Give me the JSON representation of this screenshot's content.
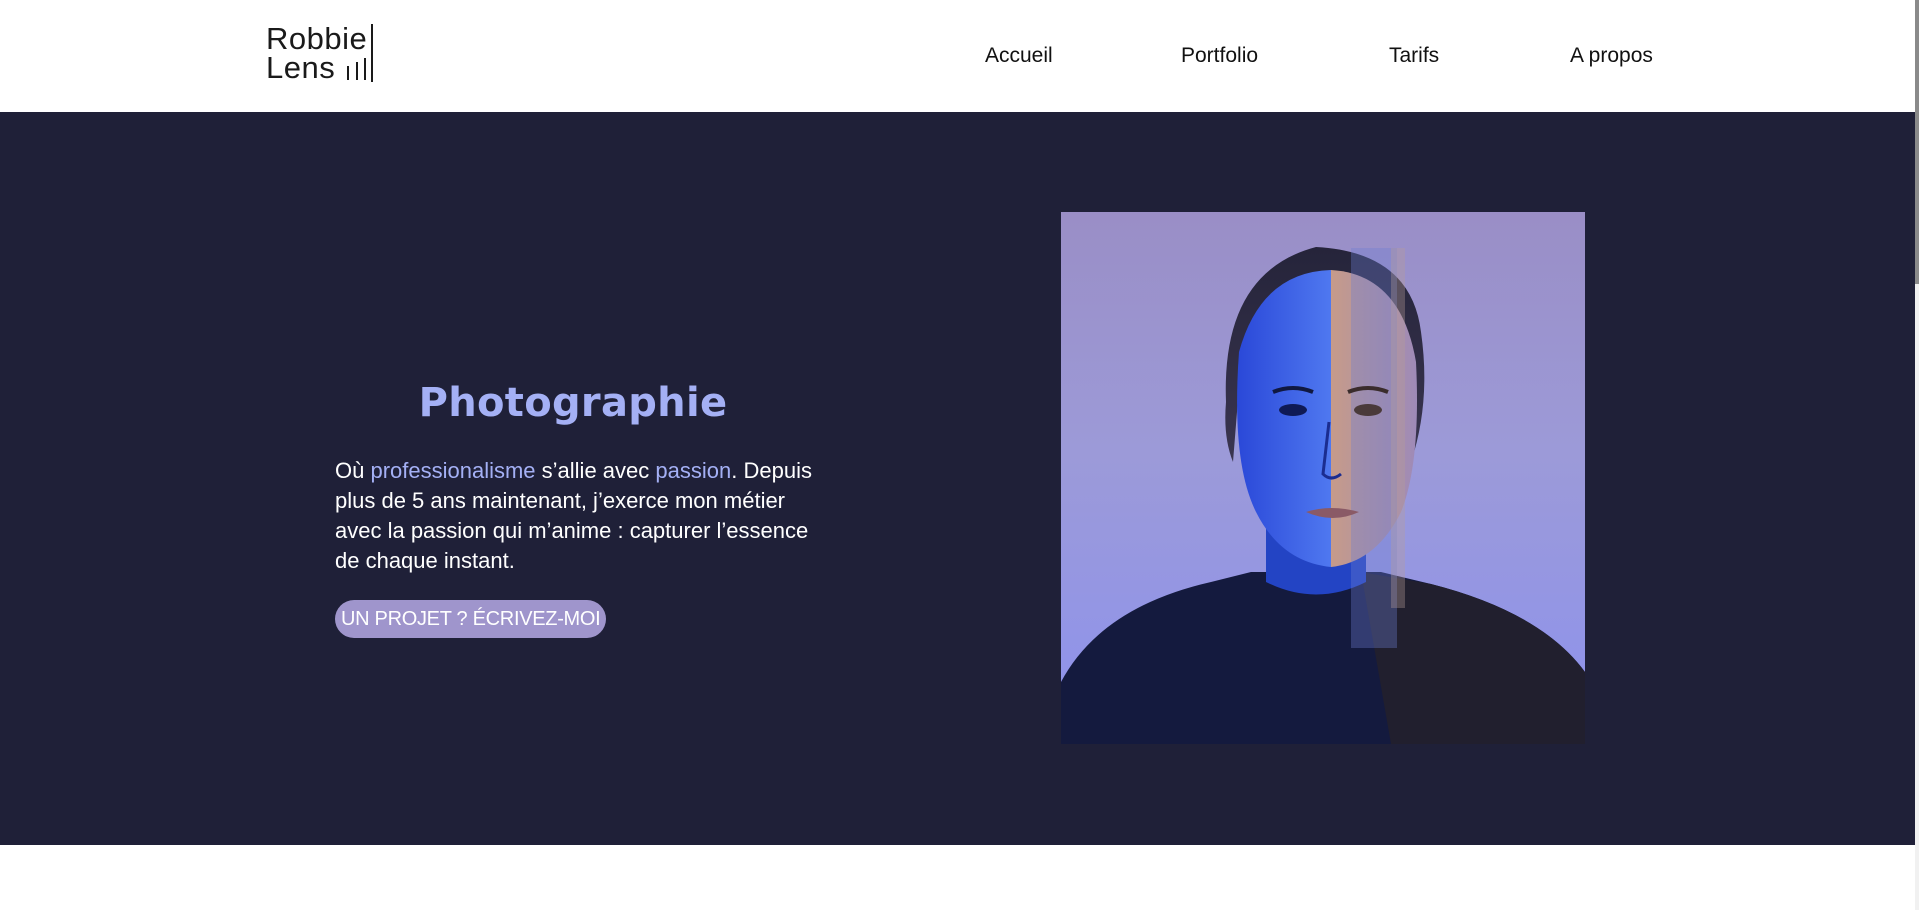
{
  "brand": {
    "line1": "Robbie",
    "line2": "Lens"
  },
  "nav": {
    "items": [
      {
        "label": "Accueil"
      },
      {
        "label": "Portfolio"
      },
      {
        "label": "Tarifs"
      },
      {
        "label": "A propos"
      }
    ]
  },
  "hero": {
    "title": "Photographie",
    "text": {
      "prefix": "Où ",
      "highlight1": "professionalisme",
      "middle": " s’allie avec ",
      "highlight2": "passion",
      "after": ".",
      "body": " Depuis plus de 5 ans maintenant, j’exerce mon métier avec la passion qui m’anime : capturer l’essence de chaque instant."
    },
    "cta_label": "UN PROJET ? ÉCRIVEZ-MOI"
  },
  "colors": {
    "hero_bg": "#1f2038",
    "accent": "#a4b0f5",
    "cta_bg": "#9f95cc"
  },
  "photo": {
    "icon": "portrait-photo"
  }
}
